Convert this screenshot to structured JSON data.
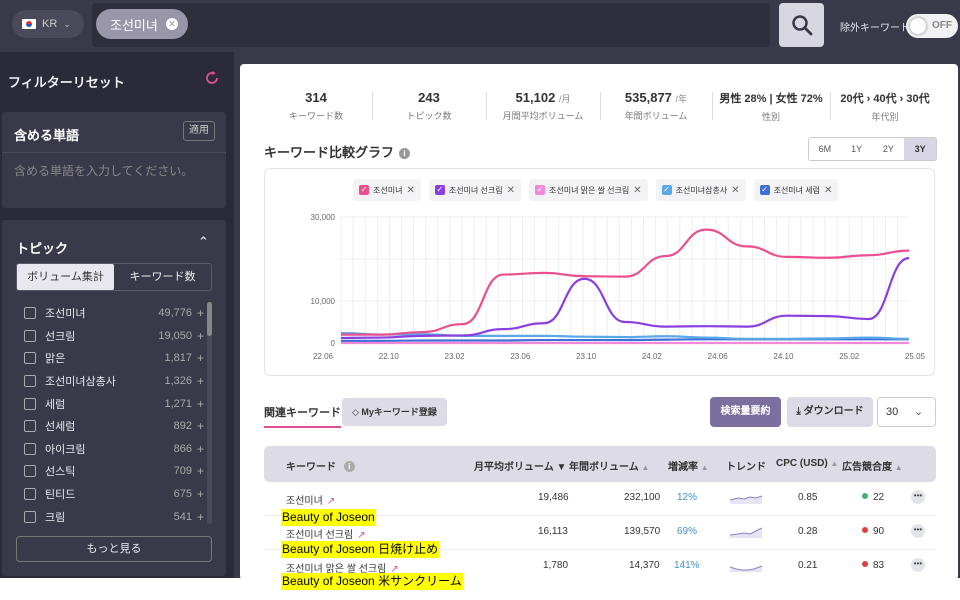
{
  "topbar": {
    "country": "KR",
    "search_chip": "조선미녀",
    "excluded_label": "除外キーワード",
    "toggle_label": "OFF"
  },
  "sidebar": {
    "filter_title": "フィルターリセット",
    "include": {
      "title": "含める単語",
      "apply": "適用",
      "placeholder": "含める単語を入力してください。"
    },
    "topic": {
      "title": "トピック",
      "seg": [
        "ボリューム集計",
        "キーワード数"
      ],
      "items": [
        {
          "name": "조선미녀",
          "count": "49,776"
        },
        {
          "name": "선크림",
          "count": "19,050"
        },
        {
          "name": "맑은",
          "count": "1,817"
        },
        {
          "name": "조선미녀삼총사",
          "count": "1,326"
        },
        {
          "name": "세럼",
          "count": "1,271"
        },
        {
          "name": "선세럼",
          "count": "892"
        },
        {
          "name": "아이크림",
          "count": "866"
        },
        {
          "name": "선스틱",
          "count": "709"
        },
        {
          "name": "틴티드",
          "count": "675"
        },
        {
          "name": "크림",
          "count": "541"
        }
      ],
      "more": "もっと見る"
    }
  },
  "stats": [
    {
      "value": "314",
      "unit": "",
      "label": "キーワード数"
    },
    {
      "value": "243",
      "unit": "",
      "label": "トピック数"
    },
    {
      "value": "51,102",
      "unit": "/月",
      "label": "月間平均ボリューム"
    },
    {
      "value": "535,877",
      "unit": "/年",
      "label": "年間ボリューム"
    },
    {
      "value": "男性 28% | 女性 72%",
      "unit": "",
      "label": "性別"
    },
    {
      "value": "20代 › 40代 › 30代",
      "unit": "",
      "label": "年代別"
    }
  ],
  "graph": {
    "title": "キーワード比較グラフ",
    "ranges": [
      "6M",
      "1Y",
      "2Y",
      "3Y"
    ],
    "active_range": "3Y"
  },
  "chart_data": {
    "type": "line",
    "x": [
      "22.06",
      "22.10",
      "23.02",
      "23.06",
      "23.10",
      "24.02",
      "24.06",
      "24.10",
      "25.02",
      "25.05"
    ],
    "ylim": [
      0,
      30000
    ],
    "yticks": [
      "30,000",
      "10,000",
      "0"
    ],
    "series": [
      {
        "name": "조선미녀",
        "color": "#ec4f8e",
        "values": [
          2000,
          2000,
          2600,
          4500,
          16300,
          16700,
          15900,
          15800,
          20700,
          27000,
          23000,
          20500,
          20300,
          20900,
          22000
        ]
      },
      {
        "name": "조선미녀 선크림",
        "color": "#8a3fe0",
        "values": [
          1200,
          1300,
          1700,
          1800,
          3300,
          4700,
          15300,
          5000,
          3900,
          4000,
          3900,
          6500,
          6400,
          5700,
          20200
        ]
      },
      {
        "name": "조선미녀 맑은 쌀 선크림",
        "color": "#f08ad8",
        "values": [
          0,
          0,
          0,
          0,
          0,
          0,
          0,
          0,
          0,
          0,
          0,
          0,
          0,
          0,
          0
        ]
      },
      {
        "name": "조선미녀삼총사",
        "color": "#5aa8e8",
        "values": [
          2400,
          2000,
          2100,
          1700,
          1700,
          1700,
          1500,
          1400,
          1600,
          1300,
          1000,
          1000,
          1100,
          1300,
          1000
        ]
      },
      {
        "name": "조선미녀 세럼",
        "color": "#3f6fd8",
        "values": [
          500,
          500,
          600,
          600,
          600,
          700,
          700,
          700,
          800,
          900,
          900,
          900,
          900,
          900,
          900
        ]
      }
    ]
  },
  "related": {
    "tab": "関連キーワード",
    "my_keyword_btn": "Myキーワード登録",
    "summary_btn": "検索量要約",
    "download_btn": "ダウンロード",
    "page_size": "30",
    "columns": [
      "キーワード",
      "月平均ボリューム",
      "年間ボリューム",
      "増減率",
      "トレンド",
      "CPC (USD)",
      "広告競合度"
    ],
    "rows": [
      {
        "keyword": "조선미녀",
        "monthly": "19,486",
        "yearly": "232,100",
        "rate": "12%",
        "cpc": "0.85",
        "comp": "22",
        "comp_color": "#3cb371"
      },
      {
        "keyword": "조선미녀 선크림",
        "monthly": "16,113",
        "yearly": "139,570",
        "rate": "69%",
        "cpc": "0.28",
        "comp": "90",
        "comp_color": "#e04040"
      },
      {
        "keyword": "조선미녀 맑은 쌀 선크림",
        "monthly": "1,780",
        "yearly": "14,370",
        "rate": "141%",
        "cpc": "0.21",
        "comp": "83",
        "comp_color": "#e04040"
      }
    ]
  },
  "highlights": [
    "Beauty of Joseon",
    "Beauty of Joseon 日焼け止め",
    "Beauty of Joseon 米サンクリーム"
  ]
}
